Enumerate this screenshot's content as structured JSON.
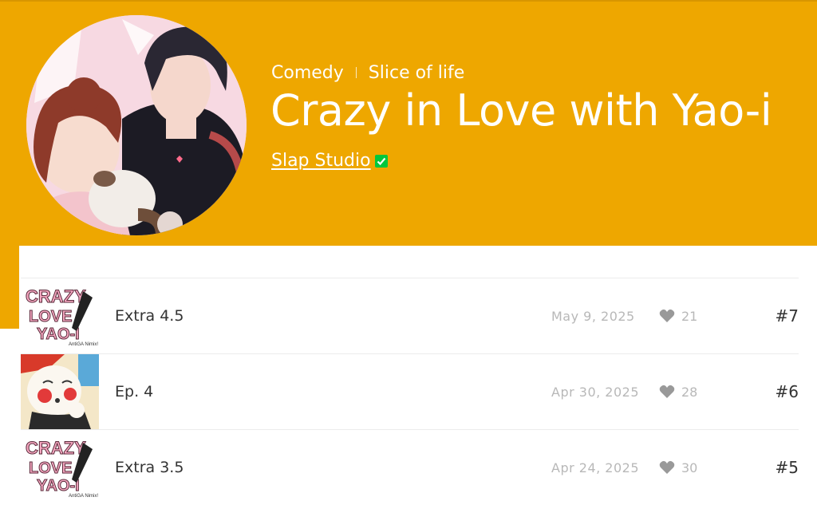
{
  "series": {
    "genres": [
      "Comedy",
      "Slice of life"
    ],
    "title": "Crazy in Love with Yao-i",
    "author": "Slap Studio"
  },
  "episodes": [
    {
      "title": "Extra 4.5",
      "date": "May 9, 2025",
      "likes": "21",
      "number": "#7",
      "thumb": "logo",
      "thumb_text": "AntiGA Nimix!"
    },
    {
      "title": "Ep. 4",
      "date": "Apr 30, 2025",
      "likes": "28",
      "number": "#6",
      "thumb": "clown"
    },
    {
      "title": "Extra 3.5",
      "date": "Apr 24, 2025",
      "likes": "30",
      "number": "#5",
      "thumb": "logo",
      "thumb_text": "AntiGA Nimix!"
    }
  ],
  "colors": {
    "hero": "#eea700",
    "verified": "#00c73c",
    "text": "#333333",
    "muted": "#b8b8b8"
  },
  "icons": {
    "likes": "heart-icon",
    "verified": "verified-check-icon"
  }
}
